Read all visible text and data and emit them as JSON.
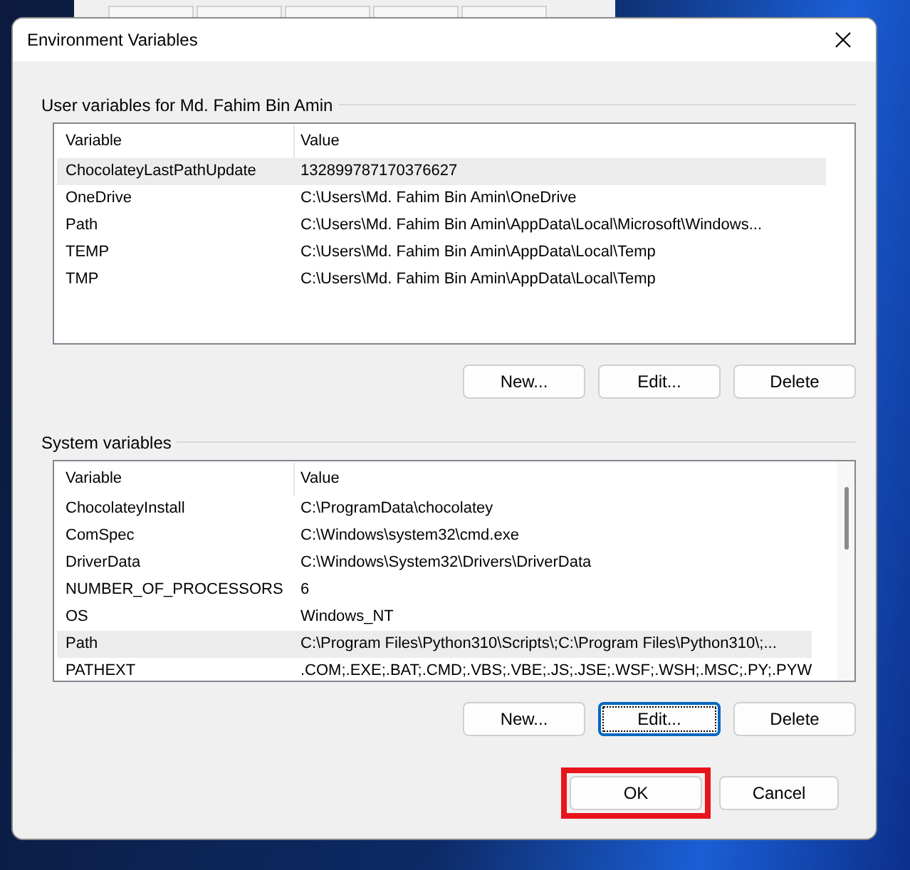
{
  "window": {
    "title": "Environment Variables"
  },
  "user_variables": {
    "title": "User variables for Md. Fahim Bin Amin",
    "columns": [
      "Variable",
      "Value"
    ],
    "rows": [
      {
        "variable": "ChocolateyLastPathUpdate",
        "value": "132899787170376627",
        "selected": true
      },
      {
        "variable": "OneDrive",
        "value": "C:\\Users\\Md. Fahim Bin Amin\\OneDrive",
        "selected": false
      },
      {
        "variable": "Path",
        "value": "C:\\Users\\Md. Fahim Bin Amin\\AppData\\Local\\Microsoft\\Windows...",
        "selected": false
      },
      {
        "variable": "TEMP",
        "value": "C:\\Users\\Md. Fahim Bin Amin\\AppData\\Local\\Temp",
        "selected": false
      },
      {
        "variable": "TMP",
        "value": "C:\\Users\\Md. Fahim Bin Amin\\AppData\\Local\\Temp",
        "selected": false
      }
    ],
    "buttons": [
      {
        "label": "New...",
        "focused": false
      },
      {
        "label": "Edit...",
        "focused": false
      },
      {
        "label": "Delete",
        "focused": false
      }
    ]
  },
  "system_variables": {
    "title": "System variables",
    "columns": [
      "Variable",
      "Value"
    ],
    "rows": [
      {
        "variable": "ChocolateyInstall",
        "value": "C:\\ProgramData\\chocolatey",
        "selected": false
      },
      {
        "variable": "ComSpec",
        "value": "C:\\Windows\\system32\\cmd.exe",
        "selected": false
      },
      {
        "variable": "DriverData",
        "value": "C:\\Windows\\System32\\Drivers\\DriverData",
        "selected": false
      },
      {
        "variable": "NUMBER_OF_PROCESSORS",
        "value": "6",
        "selected": false
      },
      {
        "variable": "OS",
        "value": "Windows_NT",
        "selected": false
      },
      {
        "variable": "Path",
        "value": "C:\\Program Files\\Python310\\Scripts\\;C:\\Program Files\\Python310\\;...",
        "selected": true
      },
      {
        "variable": "PATHEXT",
        "value": ".COM;.EXE;.BAT;.CMD;.VBS;.VBE;.JS;.JSE;.WSF;.WSH;.MSC;.PY;.PYW",
        "selected": false
      }
    ],
    "buttons": [
      {
        "label": "New...",
        "focused": false
      },
      {
        "label": "Edit...",
        "focused": true
      },
      {
        "label": "Delete",
        "focused": false
      }
    ]
  },
  "footer_buttons": [
    {
      "label": "OK",
      "highlighted": true
    },
    {
      "label": "Cancel",
      "highlighted": false
    }
  ]
}
